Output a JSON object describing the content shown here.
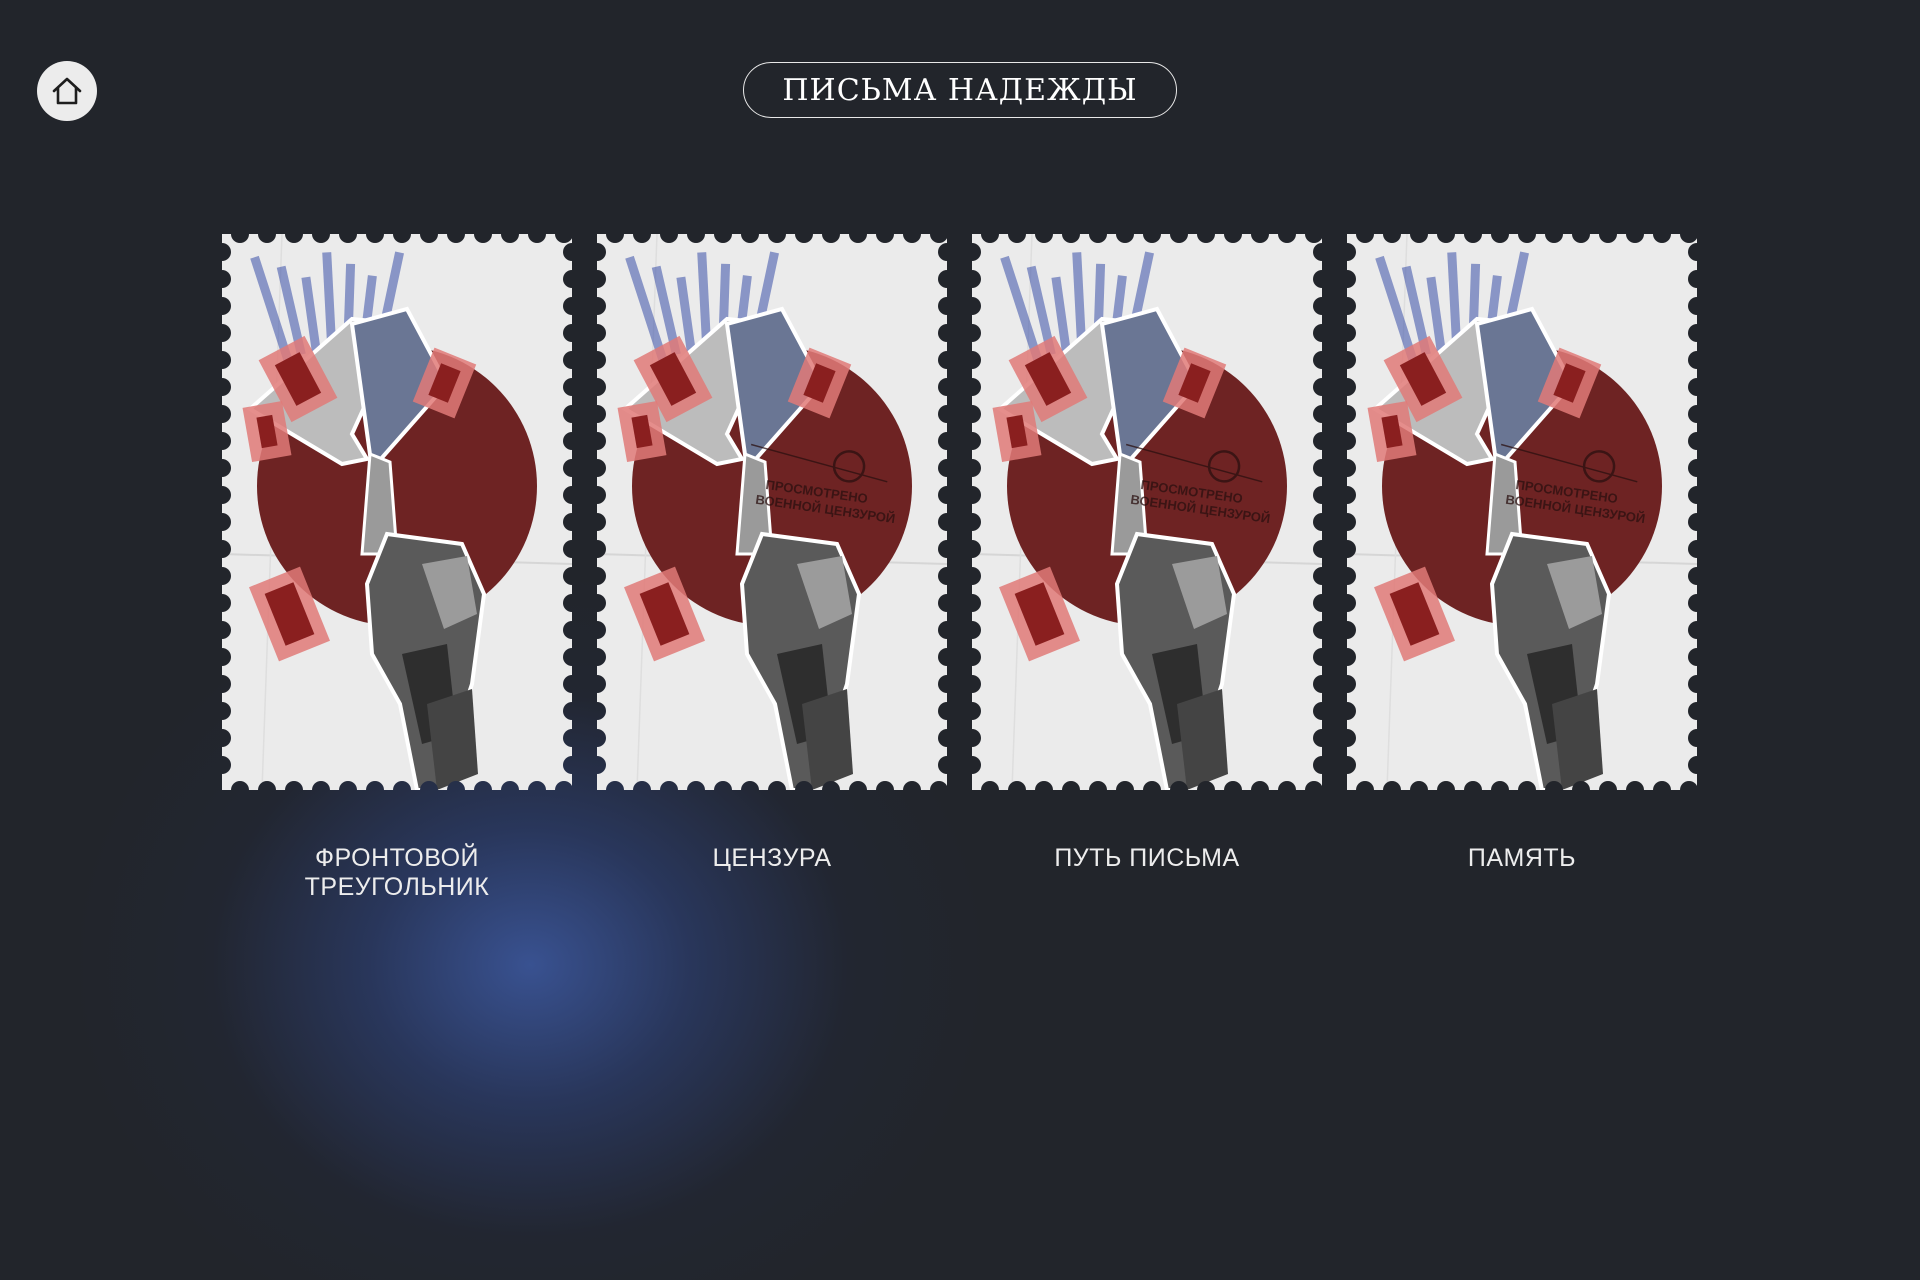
{
  "header": {
    "title": "ПИСЬМА НАДЕЖДЫ",
    "home_icon": "home-icon"
  },
  "cards": [
    {
      "label": "ФРОНТОВОЙ ТРЕУГОЛЬНИК",
      "stamp_text": ""
    },
    {
      "label": "ЦЕНЗУРА",
      "stamp_text": "ПРОСМОТРЕНО ВОЕННОЙ ЦЕНЗУРОЙ"
    },
    {
      "label": "ПУТЬ ПИСЬМА",
      "stamp_text": "ПРОСМОТРЕНО ВОЕННОЙ ЦЕНЗУРОЙ"
    },
    {
      "label": "ПАМЯТЬ",
      "stamp_text": "ПРОСМОТРЕНО ВОЕННОЙ ЦЕНЗУРОЙ"
    }
  ],
  "colors": {
    "background": "#22252b",
    "accent_red": "#6e2323",
    "paper": "#ebebeb",
    "ink_blue": "#3a4fa8",
    "glow_blue": "#3a5496"
  }
}
